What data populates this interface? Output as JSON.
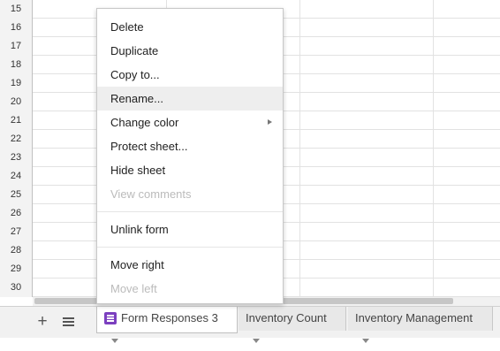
{
  "row_numbers": [
    "15",
    "16",
    "17",
    "18",
    "19",
    "20",
    "21",
    "22",
    "23",
    "24",
    "25",
    "26",
    "27",
    "28",
    "29",
    "30"
  ],
  "context_menu": {
    "items": [
      {
        "label": "Delete",
        "enabled": true
      },
      {
        "label": "Duplicate",
        "enabled": true
      },
      {
        "label": "Copy to...",
        "enabled": true
      },
      {
        "label": "Rename...",
        "enabled": true,
        "highlighted": true
      },
      {
        "label": "Change color",
        "enabled": true,
        "submenu": true
      },
      {
        "label": "Protect sheet...",
        "enabled": true
      },
      {
        "label": "Hide sheet",
        "enabled": true
      },
      {
        "label": "View comments",
        "enabled": false
      },
      {
        "label": "Unlink form",
        "enabled": true
      },
      {
        "label": "Move right",
        "enabled": true
      },
      {
        "label": "Move left",
        "enabled": false
      }
    ]
  },
  "sheet_bar": {
    "add_label": "+",
    "tabs": [
      {
        "label": "Form Responses 3",
        "active": true,
        "icon": "form-icon"
      },
      {
        "label": "Inventory Count",
        "active": false
      },
      {
        "label": "Inventory Management",
        "active": false
      }
    ]
  },
  "colors": {
    "form_icon": "#7b3fbf",
    "menu_highlight": "#eeeeee",
    "disabled_text": "#bbbbbb"
  }
}
